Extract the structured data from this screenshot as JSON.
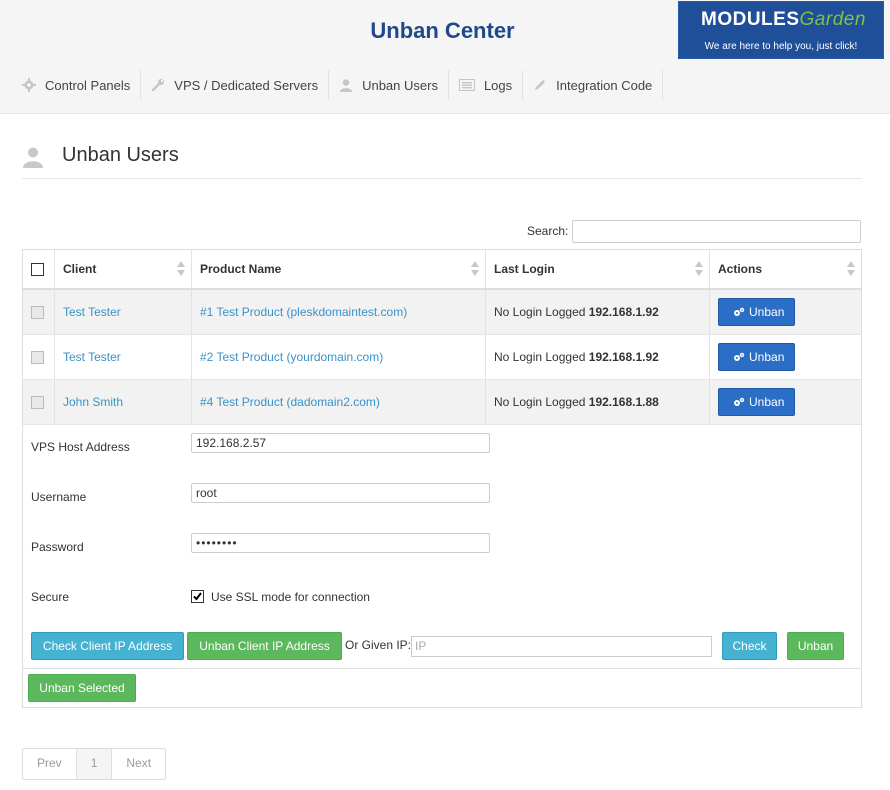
{
  "app": {
    "title": "Unban Center"
  },
  "logo": {
    "brand_main": "M",
    "brand_o": "O",
    "brand_rest": "DULES",
    "brand_garden": "Garden",
    "tagline": "We are here to help you, just click!"
  },
  "nav": [
    {
      "label": "Control Panels",
      "icon": "gear-icon"
    },
    {
      "label": "VPS / Dedicated Servers",
      "icon": "wrench-icon"
    },
    {
      "label": "Unban Users",
      "icon": "user-icon"
    },
    {
      "label": "Logs",
      "icon": "list-icon"
    },
    {
      "label": "Integration Code",
      "icon": "pencil-icon"
    }
  ],
  "page": {
    "title": "Unban Users"
  },
  "search": {
    "label": "Search:"
  },
  "table": {
    "columns": [
      "Client",
      "Product Name",
      "Last Login",
      "Actions"
    ],
    "rows": [
      {
        "client": "Test Tester",
        "product": "#1 Test Product (pleskdomaintest.com)",
        "login_text": "No Login Logged",
        "ip": "192.168.1.92",
        "action": "Unban"
      },
      {
        "client": "Test Tester",
        "product": "#2 Test Product (yourdomain.com)",
        "login_text": "No Login Logged",
        "ip": "192.168.1.92",
        "action": "Unban"
      },
      {
        "client": "John Smith",
        "product": "#4 Test Product (dadomain2.com)",
        "login_text": "No Login Logged",
        "ip": "192.168.1.88",
        "action": "Unban"
      }
    ]
  },
  "form": {
    "host_label": "VPS Host Address",
    "host_value": "192.168.2.57",
    "username_label": "Username",
    "username_value": "root",
    "password_label": "Password",
    "password_value": "••••••••",
    "secure_label": "Secure",
    "secure_option": "Use SSL mode for connection",
    "secure_checked": true
  },
  "actions": {
    "check_client_ip": "Check Client IP Address",
    "unban_client_ip": "Unban Client IP Address",
    "or_given_ip": "Or Given IP:",
    "ip_placeholder": "IP",
    "check": "Check",
    "unban": "Unban",
    "unban_selected": "Unban Selected"
  },
  "pagination": {
    "prev": "Prev",
    "current": "1",
    "next": "Next"
  },
  "colors": {
    "title": "#21498a",
    "link": "#3a92c8",
    "primary": "#2a6ec5",
    "info": "#46b2d2",
    "success": "#5cb85c"
  }
}
